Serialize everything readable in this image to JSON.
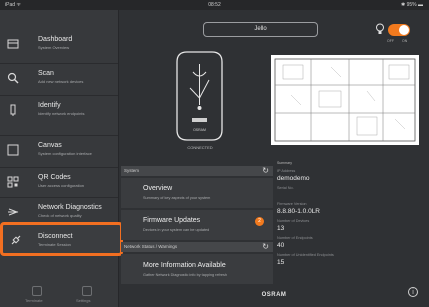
{
  "status_bar": {
    "carrier": "iPad ᯤ",
    "time": "08:52",
    "battery": "✱ 95% ▬"
  },
  "sidebar": {
    "items": [
      {
        "label": "Dashboard",
        "sub": "System Overview"
      },
      {
        "label": "Scan",
        "sub": "Add new network devices"
      },
      {
        "label": "Identify",
        "sub": "Identify network endpoints"
      },
      {
        "label": "Canvas",
        "sub": "System configuration interface"
      },
      {
        "label": "QR Codes",
        "sub": "User access configuration"
      },
      {
        "label": "Network Diagnostics",
        "sub": "Check of network quality"
      },
      {
        "label": "Disconnect",
        "sub": "Terminate Session"
      }
    ],
    "footer": {
      "left": "Terminate",
      "right": "Settings"
    }
  },
  "header": {
    "device_name": "Jello",
    "toggle": {
      "off": "OFF",
      "on": "ON",
      "state": "on"
    }
  },
  "device": {
    "status": "CONNECTED",
    "brand_small": "OSRAM"
  },
  "system_panel": {
    "header": "System",
    "overview": {
      "title": "Overview",
      "sub": "Summary of key aspects of your system"
    },
    "firmware": {
      "title": "Firmware Updates",
      "sub": "Devices in your system can be updated",
      "badge": "2"
    }
  },
  "network_panel": {
    "header": "Network Status / Warnings",
    "info": {
      "title": "More Information Available",
      "sub": "Gather Network Diagnostic info by tapping refresh"
    }
  },
  "summary": {
    "header": "Summary",
    "fields": [
      {
        "label": "IP Address",
        "value": "demodemo"
      },
      {
        "label": "Serial No.",
        "value": ""
      },
      {
        "label": "Firmware Version",
        "value": "8.8.80-1.0.0LR"
      },
      {
        "label": "Number of Devices",
        "value": "13"
      },
      {
        "label": "Number of Endpoints",
        "value": "40"
      },
      {
        "label": "Number of Unidentified Endpoints",
        "value": "15"
      }
    ]
  },
  "footer": {
    "brand": "OSRAM",
    "info": "i"
  },
  "colors": {
    "accent": "#f27a1e",
    "highlight": "#f26f21",
    "sidebar": "#37393c",
    "background": "#2f3134"
  }
}
